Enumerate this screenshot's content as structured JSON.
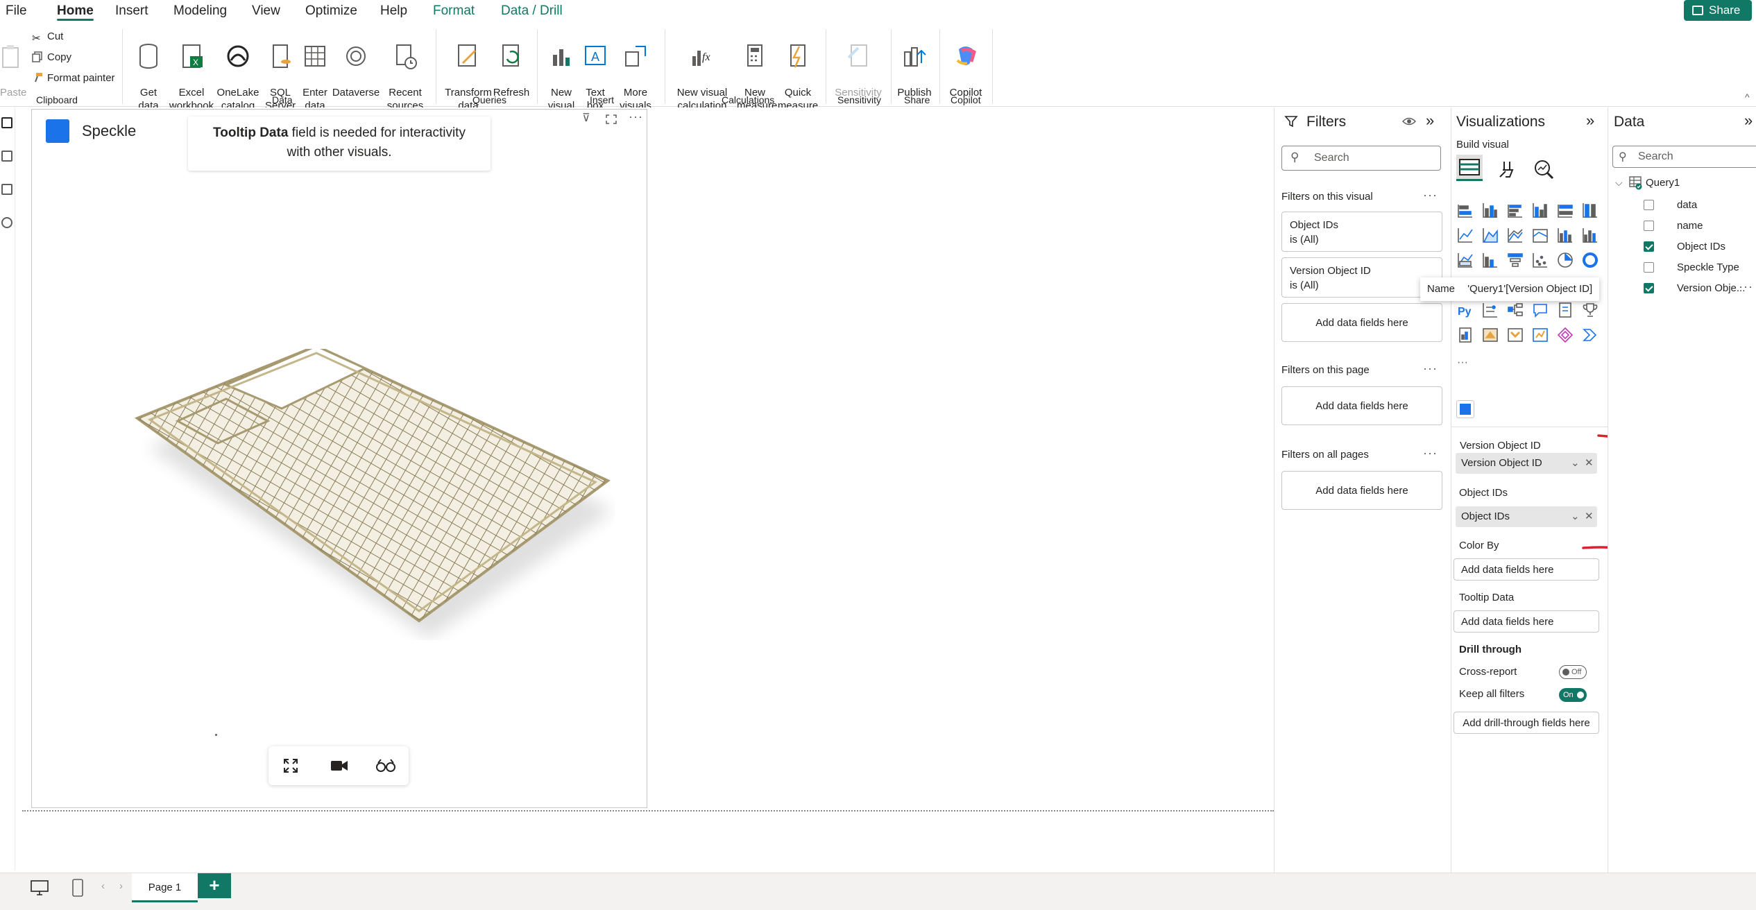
{
  "menu": {
    "tabs": [
      "File",
      "Home",
      "Insert",
      "Modeling",
      "View",
      "Optimize",
      "Help",
      "Format",
      "Data / Drill"
    ],
    "share_label": "Share"
  },
  "ribbon": {
    "clipboard": {
      "paste": "Paste",
      "cut": "Cut",
      "copy": "Copy",
      "format_painter": "Format painter",
      "group": "Clipboard"
    },
    "data": {
      "get_data": "Get\ndata",
      "excel": "Excel\nworkbook",
      "onelake": "OneLake\ncatalog",
      "sql": "SQL\nServer",
      "enter": "Enter\ndata",
      "dataverse": "Dataverse",
      "recent": "Recent\nsources",
      "group": "Data"
    },
    "queries": {
      "transform": "Transform\ndata",
      "refresh": "Refresh",
      "group": "Queries"
    },
    "insert": {
      "new_visual": "New\nvisual",
      "text_box": "Text\nbox",
      "more_visuals": "More\nvisuals",
      "group": "Insert"
    },
    "calculations": {
      "new_visual_calc": "New visual\ncalculation",
      "new_measure": "New\nmeasure",
      "quick_measure": "Quick\nmeasure",
      "group": "Calculations"
    },
    "sensitivity": {
      "label": "Sensitivity",
      "group": "Sensitivity"
    },
    "share": {
      "publish": "Publish",
      "group": "Share"
    },
    "copilot": {
      "label": "Copilot",
      "group": "Copilot"
    }
  },
  "visual": {
    "title": "Speckle",
    "notice_bold": "Tooltip Data",
    "notice_rest": " field is needed for interactivity",
    "notice_line2": "with other visuals."
  },
  "filters": {
    "title": "Filters",
    "search_placeholder": "Search",
    "on_visual_label": "Filters on this visual",
    "cards": [
      {
        "name": "Object IDs",
        "value": "is (All)"
      },
      {
        "name": "Version Object ID",
        "value": "is (All)"
      }
    ],
    "add_fields": "Add data fields here",
    "on_page_label": "Filters on this page",
    "on_all_pages_label": "Filters on all pages"
  },
  "visualizations": {
    "title": "Visualizations",
    "build_visual": "Build visual",
    "wells": {
      "version_object_id_label": "Version Object ID",
      "version_object_id_value": "Version Object ID",
      "object_ids_label": "Object IDs",
      "object_ids_value": "Object IDs",
      "color_by_label": "Color By",
      "color_by_add": "Add data fields here",
      "tooltip_label": "Tooltip Data",
      "tooltip_add": "Add data fields here"
    },
    "drill": {
      "label": "Drill through",
      "cross_report": "Cross-report",
      "cross_report_state": "Off",
      "keep_filters": "Keep all filters",
      "keep_filters_state": "On",
      "add": "Add drill-through fields here"
    }
  },
  "tooltip": {
    "label": "Name",
    "value": "'Query1'[Version Object ID]"
  },
  "data_pane": {
    "title": "Data",
    "search_placeholder": "Search",
    "table": "Query1",
    "fields": [
      {
        "name": "data",
        "checked": false
      },
      {
        "name": "name",
        "checked": false
      },
      {
        "name": "Object IDs",
        "checked": true
      },
      {
        "name": "Speckle Type",
        "checked": false
      },
      {
        "name": "Version Obje...",
        "checked": true
      }
    ]
  },
  "bottom": {
    "page_tab": "Page 1",
    "add_page": "+"
  },
  "colors": {
    "accent": "#117865",
    "annotation": "#d9232e"
  }
}
